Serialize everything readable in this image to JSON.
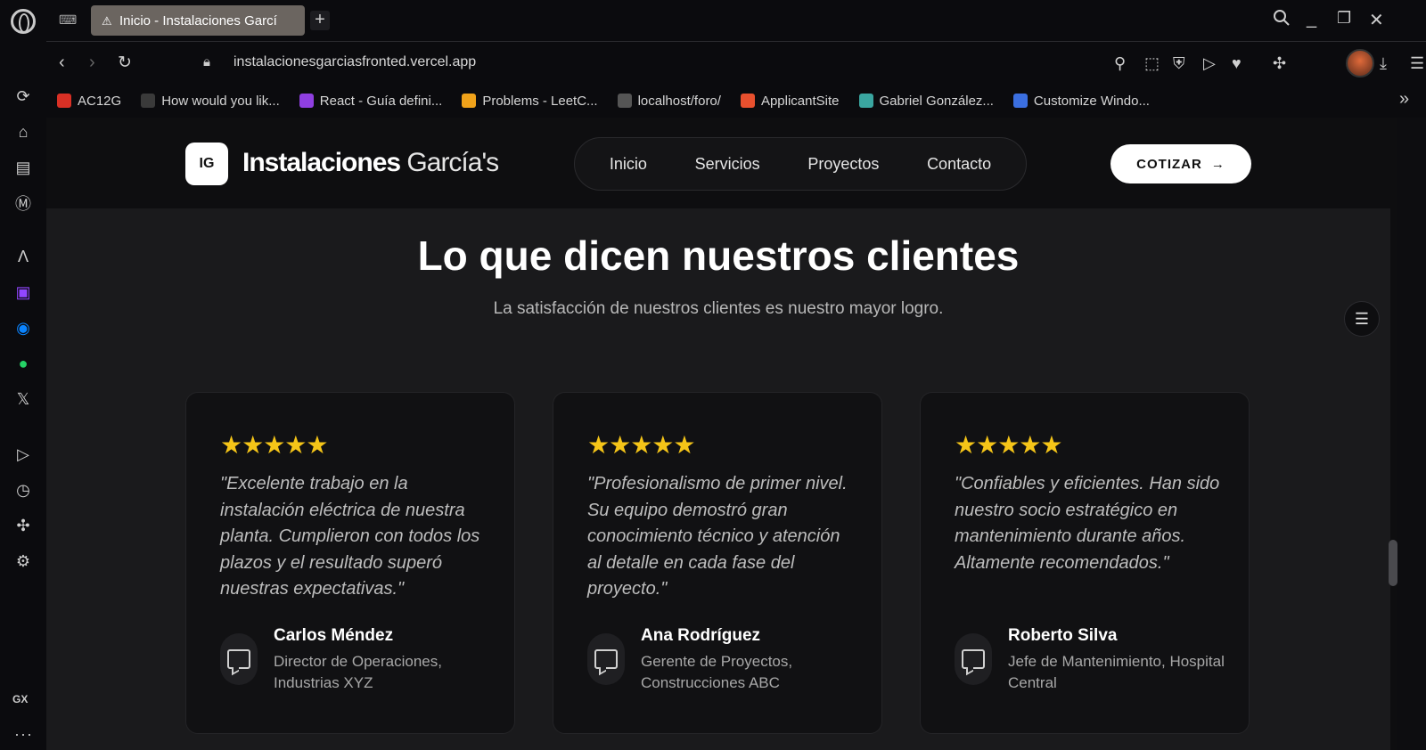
{
  "browser": {
    "tab_title": "Inicio - Instalaciones Garcí",
    "url_host": "instalacionesgarciasfronted",
    "url_domain": ".vercel.app",
    "bookmarks": [
      {
        "label": "AC12G",
        "icon": "gmail-icon",
        "color": "#d93025"
      },
      {
        "label": "How would you lik...",
        "icon": "upwork-icon",
        "color": "#3a3a3a"
      },
      {
        "label": "React - Guía defini...",
        "icon": "udemy-icon",
        "color": "#8f3fe0"
      },
      {
        "label": "Problems - LeetC...",
        "icon": "leetcode-icon",
        "color": "#f0a21a"
      },
      {
        "label": "localhost/foro/",
        "icon": "file-icon",
        "color": "#555555"
      },
      {
        "label": "ApplicantSite",
        "icon": "applicant-icon",
        "color": "#e8502e"
      },
      {
        "label": "Gabriel González...",
        "icon": "site-icon",
        "color": "#3aa6a0"
      },
      {
        "label": "Customize Windo...",
        "icon": "vs-icon",
        "color": "#3b6fe0"
      }
    ],
    "sidebar_label": "GX"
  },
  "site": {
    "badge": "IG",
    "brand_bold": "Instalaciones",
    "brand_thin": "García's",
    "nav": [
      "Inicio",
      "Servicios",
      "Proyectos",
      "Contacto"
    ],
    "cta": "COTIZAR",
    "cta_arrow": "→"
  },
  "testimonials": {
    "title": "Lo que dicen nuestros clientes",
    "subtitle": "La satisfacción de nuestros clientes es nuestro mayor logro.",
    "rating_stars": "★★★★★",
    "items": [
      {
        "quote": "\"Excelente trabajo en la instalación eléctrica de nuestra planta. Cumplieron con todos los plazos y el resultado superó nuestras expectativas.\"",
        "name": "Carlos Méndez",
        "role": "Director de Operaciones, Industrias XYZ"
      },
      {
        "quote": "\"Profesionalismo de primer nivel. Su equipo demostró gran conocimiento técnico y atención al detalle en cada fase del proyecto.\"",
        "name": "Ana Rodríguez",
        "role": "Gerente de Proyectos, Construcciones ABC"
      },
      {
        "quote": "\"Confiables y eficientes. Han sido nuestro socio estratégico en mantenimiento durante años. Altamente recomendados.\"",
        "name": "Roberto Silva",
        "role": "Jefe de Mantenimiento, Hospital Central"
      }
    ]
  }
}
